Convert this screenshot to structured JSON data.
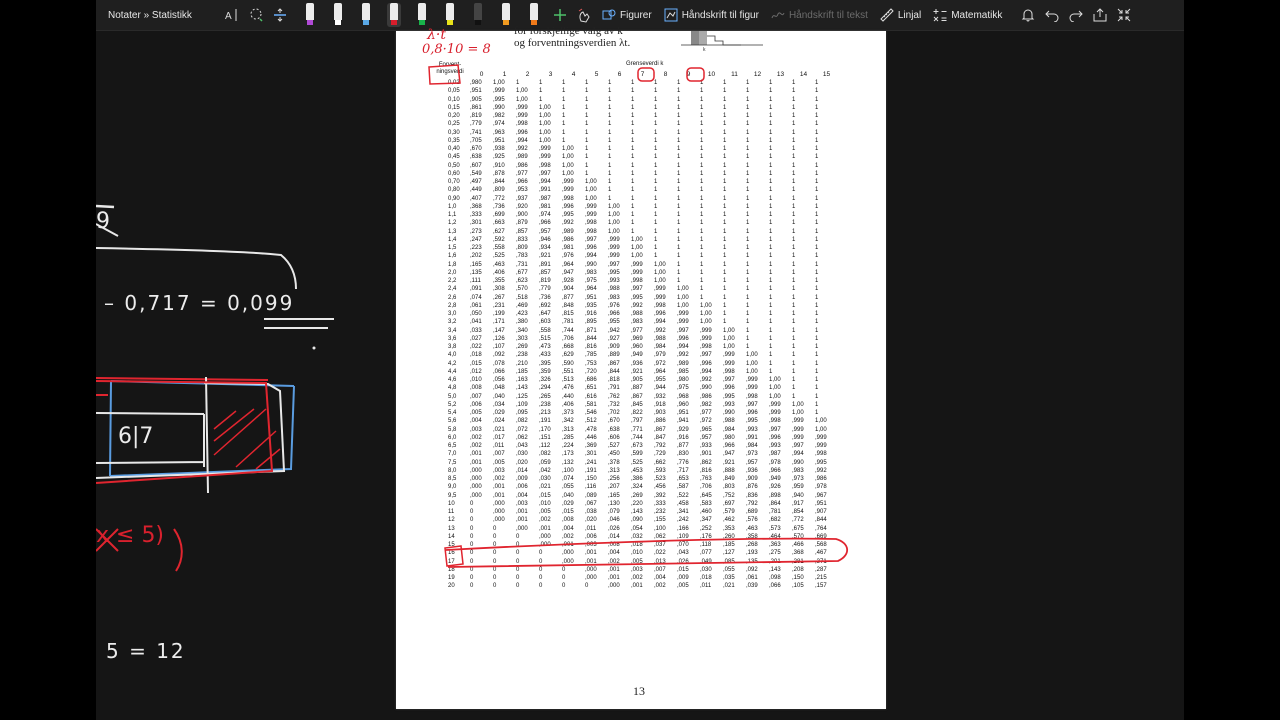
{
  "toolbar": {
    "breadcrumb": "Notater » Statistikk",
    "figures_label": "Figurer",
    "handwriting_to_shape_label": "Håndskrift til figur",
    "handwriting_to_text_label": "Håndskrift til tekst",
    "ruler_label": "Linjal",
    "math_label": "Matematikk",
    "pens": [
      {
        "name": "pen-purple",
        "color": "#b04ad6"
      },
      {
        "name": "pen-white",
        "color": "#ffffff"
      },
      {
        "name": "pen-blue",
        "color": "#5aa8e6"
      },
      {
        "name": "pen-red",
        "color": "#d81e2c"
      },
      {
        "name": "pen-green",
        "color": "#19b24a"
      },
      {
        "name": "pen-yellow",
        "color": "#e8e21a"
      },
      {
        "name": "pen-black",
        "color": "#111111"
      },
      {
        "name": "pen-orange",
        "color": "#f19a20"
      },
      {
        "name": "pen-orange-2",
        "color": "#f07a1a"
      }
    ]
  },
  "page": {
    "header_line1": "for forskjellige valg av k",
    "header_line2": "og forventningsverdien λt.",
    "col_label": "Forvent-ningsverdi",
    "grense_label": "Grenseverdi k",
    "page_number": "13",
    "columns": [
      "0",
      "1",
      "2",
      "3",
      "4",
      "5",
      "6",
      "7",
      "8",
      "9",
      "10",
      "11",
      "12",
      "13",
      "14",
      "15"
    ],
    "rows": [
      [
        "0,02",
        ",980",
        "1,00",
        "1",
        "1",
        "1",
        "1",
        "1",
        "1",
        "1",
        "1",
        "1",
        "1",
        "1",
        "1",
        "1",
        "1"
      ],
      [
        "0,05",
        ",951",
        ",999",
        "1,00",
        "1",
        "1",
        "1",
        "1",
        "1",
        "1",
        "1",
        "1",
        "1",
        "1",
        "1",
        "1",
        "1"
      ],
      [
        "0,10",
        ",905",
        ",995",
        "1,00",
        "1",
        "1",
        "1",
        "1",
        "1",
        "1",
        "1",
        "1",
        "1",
        "1",
        "1",
        "1",
        "1"
      ],
      [
        "0,15",
        ",861",
        ",990",
        ",999",
        "1,00",
        "1",
        "1",
        "1",
        "1",
        "1",
        "1",
        "1",
        "1",
        "1",
        "1",
        "1",
        "1"
      ],
      [
        "0,20",
        ",819",
        ",982",
        ",999",
        "1,00",
        "1",
        "1",
        "1",
        "1",
        "1",
        "1",
        "1",
        "1",
        "1",
        "1",
        "1",
        "1"
      ],
      [
        "0,25",
        ",779",
        ",974",
        ",998",
        "1,00",
        "1",
        "1",
        "1",
        "1",
        "1",
        "1",
        "1",
        "1",
        "1",
        "1",
        "1",
        "1"
      ],
      [
        "0,30",
        ",741",
        ",963",
        ",996",
        "1,00",
        "1",
        "1",
        "1",
        "1",
        "1",
        "1",
        "1",
        "1",
        "1",
        "1",
        "1",
        "1"
      ],
      [
        "0,35",
        ",705",
        ",951",
        ",994",
        "1,00",
        "1",
        "1",
        "1",
        "1",
        "1",
        "1",
        "1",
        "1",
        "1",
        "1",
        "1",
        "1"
      ],
      [
        "0,40",
        ",670",
        ",938",
        ",992",
        ",999",
        "1,00",
        "1",
        "1",
        "1",
        "1",
        "1",
        "1",
        "1",
        "1",
        "1",
        "1",
        "1"
      ],
      [
        "0,45",
        ",638",
        ",925",
        ",989",
        ",999",
        "1,00",
        "1",
        "1",
        "1",
        "1",
        "1",
        "1",
        "1",
        "1",
        "1",
        "1",
        "1"
      ],
      [
        "0,50",
        ",607",
        ",910",
        ",986",
        ",998",
        "1,00",
        "1",
        "1",
        "1",
        "1",
        "1",
        "1",
        "1",
        "1",
        "1",
        "1",
        "1"
      ],
      [
        "0,60",
        ",549",
        ",878",
        ",977",
        ",997",
        "1,00",
        "1",
        "1",
        "1",
        "1",
        "1",
        "1",
        "1",
        "1",
        "1",
        "1",
        "1"
      ],
      [
        "0,70",
        ",497",
        ",844",
        ",966",
        ",994",
        ",999",
        "1,00",
        "1",
        "1",
        "1",
        "1",
        "1",
        "1",
        "1",
        "1",
        "1",
        "1"
      ],
      [
        "0,80",
        ",449",
        ",809",
        ",953",
        ",991",
        ",999",
        "1,00",
        "1",
        "1",
        "1",
        "1",
        "1",
        "1",
        "1",
        "1",
        "1",
        "1"
      ],
      [
        "0,90",
        ",407",
        ",772",
        ",937",
        ",987",
        ",998",
        "1,00",
        "1",
        "1",
        "1",
        "1",
        "1",
        "1",
        "1",
        "1",
        "1",
        "1"
      ],
      [
        "1,0",
        ",368",
        ",736",
        ",920",
        ",981",
        ",996",
        ",999",
        "1,00",
        "1",
        "1",
        "1",
        "1",
        "1",
        "1",
        "1",
        "1",
        "1"
      ],
      [
        "1,1",
        ",333",
        ",699",
        ",900",
        ",974",
        ",995",
        ",999",
        "1,00",
        "1",
        "1",
        "1",
        "1",
        "1",
        "1",
        "1",
        "1",
        "1"
      ],
      [
        "1,2",
        ",301",
        ",663",
        ",879",
        ",966",
        ",992",
        ",998",
        "1,00",
        "1",
        "1",
        "1",
        "1",
        "1",
        "1",
        "1",
        "1",
        "1"
      ],
      [
        "1,3",
        ",273",
        ",627",
        ",857",
        ",957",
        ",989",
        ",998",
        "1,00",
        "1",
        "1",
        "1",
        "1",
        "1",
        "1",
        "1",
        "1",
        "1"
      ],
      [
        "1,4",
        ",247",
        ",592",
        ",833",
        ",946",
        ",986",
        ",997",
        ",999",
        "1,00",
        "1",
        "1",
        "1",
        "1",
        "1",
        "1",
        "1",
        "1"
      ],
      [
        "1,5",
        ",223",
        ",558",
        ",809",
        ",934",
        ",981",
        ",996",
        ",999",
        "1,00",
        "1",
        "1",
        "1",
        "1",
        "1",
        "1",
        "1",
        "1"
      ],
      [
        "1,6",
        ",202",
        ",525",
        ",783",
        ",921",
        ",976",
        ",994",
        ",999",
        "1,00",
        "1",
        "1",
        "1",
        "1",
        "1",
        "1",
        "1",
        "1"
      ],
      [
        "1,8",
        ",165",
        ",463",
        ",731",
        ",891",
        ",964",
        ",990",
        ",997",
        ",999",
        "1,00",
        "1",
        "1",
        "1",
        "1",
        "1",
        "1",
        "1"
      ],
      [
        "2,0",
        ",135",
        ",406",
        ",677",
        ",857",
        ",947",
        ",983",
        ",995",
        ",999",
        "1,00",
        "1",
        "1",
        "1",
        "1",
        "1",
        "1",
        "1"
      ],
      [
        "2,2",
        ",111",
        ",355",
        ",623",
        ",819",
        ",928",
        ",975",
        ",993",
        ",998",
        "1,00",
        "1",
        "1",
        "1",
        "1",
        "1",
        "1",
        "1"
      ],
      [
        "2,4",
        ",091",
        ",308",
        ",570",
        ",779",
        ",904",
        ",964",
        ",988",
        ",997",
        ",999",
        "1,00",
        "1",
        "1",
        "1",
        "1",
        "1",
        "1"
      ],
      [
        "2,6",
        ",074",
        ",267",
        ",518",
        ",736",
        ",877",
        ",951",
        ",983",
        ",995",
        ",999",
        "1,00",
        "1",
        "1",
        "1",
        "1",
        "1",
        "1"
      ],
      [
        "2,8",
        ",061",
        ",231",
        ",469",
        ",692",
        ",848",
        ",935",
        ",976",
        ",992",
        ",998",
        "1,00",
        "1,00",
        "1",
        "1",
        "1",
        "1",
        "1"
      ],
      [
        "3,0",
        ",050",
        ",199",
        ",423",
        ",647",
        ",815",
        ",916",
        ",966",
        ",988",
        ",996",
        ",999",
        "1,00",
        "1",
        "1",
        "1",
        "1",
        "1"
      ],
      [
        "3,2",
        ",041",
        ",171",
        ",380",
        ",603",
        ",781",
        ",895",
        ",955",
        ",983",
        ",994",
        ",999",
        "1,00",
        "1",
        "1",
        "1",
        "1",
        "1"
      ],
      [
        "3,4",
        ",033",
        ",147",
        ",340",
        ",558",
        ",744",
        ",871",
        ",942",
        ",977",
        ",992",
        ",997",
        ",999",
        "1,00",
        "1",
        "1",
        "1",
        "1"
      ],
      [
        "3,6",
        ",027",
        ",126",
        ",303",
        ",515",
        ",706",
        ",844",
        ",927",
        ",969",
        ",988",
        ",996",
        ",999",
        "1,00",
        "1",
        "1",
        "1",
        "1"
      ],
      [
        "3,8",
        ",022",
        ",107",
        ",269",
        ",473",
        ",668",
        ",816",
        ",909",
        ",960",
        ",984",
        ",994",
        ",998",
        "1,00",
        "1",
        "1",
        "1",
        "1"
      ],
      [
        "4,0",
        ",018",
        ",092",
        ",238",
        ",433",
        ",629",
        ",785",
        ",889",
        ",949",
        ",979",
        ",992",
        ",997",
        ",999",
        "1,00",
        "1",
        "1",
        "1"
      ],
      [
        "4,2",
        ",015",
        ",078",
        ",210",
        ",395",
        ",590",
        ",753",
        ",867",
        ",936",
        ",972",
        ",989",
        ",996",
        ",999",
        "1,00",
        "1",
        "1",
        "1"
      ],
      [
        "4,4",
        ",012",
        ",066",
        ",185",
        ",359",
        ",551",
        ",720",
        ",844",
        ",921",
        ",964",
        ",985",
        ",994",
        ",998",
        "1,00",
        "1",
        "1",
        "1"
      ],
      [
        "4,6",
        ",010",
        ",056",
        ",163",
        ",326",
        ",513",
        ",686",
        ",818",
        ",905",
        ",955",
        ",980",
        ",992",
        ",997",
        ",999",
        "1,00",
        "1",
        "1"
      ],
      [
        "4,8",
        ",008",
        ",048",
        ",143",
        ",294",
        ",476",
        ",651",
        ",791",
        ",887",
        ",944",
        ",975",
        ",990",
        ",996",
        ",999",
        "1,00",
        "1",
        "1"
      ],
      [
        "5,0",
        ",007",
        ",040",
        ",125",
        ",265",
        ",440",
        ",616",
        ",762",
        ",867",
        ",932",
        ",968",
        ",986",
        ",995",
        ",998",
        "1,00",
        "1",
        "1"
      ],
      [
        "5,2",
        ",006",
        ",034",
        ",109",
        ",238",
        ",406",
        ",581",
        ",732",
        ",845",
        ",918",
        ",960",
        ",982",
        ",993",
        ",997",
        ",999",
        "1,00",
        "1"
      ],
      [
        "5,4",
        ",005",
        ",029",
        ",095",
        ",213",
        ",373",
        ",546",
        ",702",
        ",822",
        ",903",
        ",951",
        ",977",
        ",990",
        ",996",
        ",999",
        "1,00",
        "1"
      ],
      [
        "5,6",
        ",004",
        ",024",
        ",082",
        ",191",
        ",342",
        ",512",
        ",670",
        ",797",
        ",886",
        ",941",
        ",972",
        ",988",
        ",995",
        ",998",
        ",999",
        "1,00"
      ],
      [
        "5,8",
        ",003",
        ",021",
        ",072",
        ",170",
        ",313",
        ",478",
        ",638",
        ",771",
        ",867",
        ",929",
        ",965",
        ",984",
        ",993",
        ",997",
        ",999",
        "1,00"
      ],
      [
        "6,0",
        ",002",
        ",017",
        ",062",
        ",151",
        ",285",
        ",446",
        ",606",
        ",744",
        ",847",
        ",916",
        ",957",
        ",980",
        ",991",
        ",996",
        ",999",
        ",999"
      ],
      [
        "6,5",
        ",002",
        ",011",
        ",043",
        ",112",
        ",224",
        ",369",
        ",527",
        ",673",
        ",792",
        ",877",
        ",933",
        ",966",
        ",984",
        ",993",
        ",997",
        ",999"
      ],
      [
        "7,0",
        ",001",
        ",007",
        ",030",
        ",082",
        ",173",
        ",301",
        ",450",
        ",599",
        ",729",
        ",830",
        ",901",
        ",947",
        ",973",
        ",987",
        ",994",
        ",998"
      ],
      [
        "7,5",
        ",001",
        ",005",
        ",020",
        ",059",
        ",132",
        ",241",
        ",378",
        ",525",
        ",662",
        ",776",
        ",862",
        ",921",
        ",957",
        ",978",
        ",990",
        ",995"
      ],
      [
        "8,0",
        ",000",
        ",003",
        ",014",
        ",042",
        ",100",
        ",191",
        ",313",
        ",453",
        ",593",
        ",717",
        ",816",
        ",888",
        ",936",
        ",966",
        ",983",
        ",992"
      ],
      [
        "8,5",
        ",000",
        ",002",
        ",009",
        ",030",
        ",074",
        ",150",
        ",256",
        ",386",
        ",523",
        ",653",
        ",763",
        ",849",
        ",909",
        ",949",
        ",973",
        ",986"
      ],
      [
        "9,0",
        ",000",
        ",001",
        ",006",
        ",021",
        ",055",
        ",116",
        ",207",
        ",324",
        ",456",
        ",587",
        ",706",
        ",803",
        ",876",
        ",926",
        ",959",
        ",978"
      ],
      [
        "9,5",
        ",000",
        ",001",
        ",004",
        ",015",
        ",040",
        ",089",
        ",165",
        ",269",
        ",392",
        ",522",
        ",645",
        ",752",
        ",836",
        ",898",
        ",940",
        ",967"
      ],
      [
        "10",
        "0",
        ",000",
        ",003",
        ",010",
        ",029",
        ",067",
        ",130",
        ",220",
        ",333",
        ",458",
        ",583",
        ",697",
        ",792",
        ",864",
        ",917",
        ",951"
      ],
      [
        "11",
        "0",
        ",000",
        ",001",
        ",005",
        ",015",
        ",038",
        ",079",
        ",143",
        ",232",
        ",341",
        ",460",
        ",579",
        ",689",
        ",781",
        ",854",
        ",907"
      ],
      [
        "12",
        "0",
        ",000",
        ",001",
        ",002",
        ",008",
        ",020",
        ",046",
        ",090",
        ",155",
        ",242",
        ",347",
        ",462",
        ",576",
        ",682",
        ",772",
        ",844"
      ],
      [
        "13",
        "0",
        "0",
        ",000",
        ",001",
        ",004",
        ",011",
        ",026",
        ",054",
        ",100",
        ",166",
        ",252",
        ",353",
        ",463",
        ",573",
        ",675",
        ",764"
      ],
      [
        "14",
        "0",
        "0",
        "0",
        ",000",
        ",002",
        ",006",
        ",014",
        ",032",
        ",062",
        ",109",
        ",176",
        ",260",
        ",358",
        ",464",
        ",570",
        ",669"
      ],
      [
        "15",
        "0",
        "0",
        "0",
        ",000",
        ",001",
        ",003",
        ",008",
        ",018",
        ",037",
        ",070",
        ",118",
        ",185",
        ",268",
        ",363",
        ",466",
        ",568"
      ],
      [
        "16",
        "0",
        "0",
        "0",
        "0",
        ",000",
        ",001",
        ",004",
        ",010",
        ",022",
        ",043",
        ",077",
        ",127",
        ",193",
        ",275",
        ",368",
        ",467"
      ],
      [
        "17",
        "0",
        "0",
        "0",
        "0",
        ",000",
        ",001",
        ",002",
        ",005",
        ",013",
        ",026",
        ",049",
        ",085",
        ",135",
        ",201",
        ",281",
        ",371"
      ],
      [
        "18",
        "0",
        "0",
        "0",
        "0",
        "0",
        ",000",
        ",001",
        ",003",
        ",007",
        ",015",
        ",030",
        ",055",
        ",092",
        ",143",
        ",208",
        ",287"
      ],
      [
        "19",
        "0",
        "0",
        "0",
        "0",
        "0",
        ",000",
        ",001",
        ",002",
        ",004",
        ",009",
        ",018",
        ",035",
        ",061",
        ",098",
        ",150",
        ",215"
      ],
      [
        "20",
        "0",
        "0",
        "0",
        "0",
        "0",
        "0",
        ",000",
        ",001",
        ",002",
        ",005",
        ",011",
        ",021",
        ",039",
        ",066",
        ",105",
        ",157"
      ]
    ]
  },
  "handwriting": {
    "lambda_t": "λ·t",
    "lambda_calc": "0,8·10 = 8",
    "fragment_9": "9",
    "result": "– 0,717 = 0,099",
    "box_label": "6|7",
    "ineq": "x ≤ 5)",
    "five_eq": "5 = 12"
  }
}
